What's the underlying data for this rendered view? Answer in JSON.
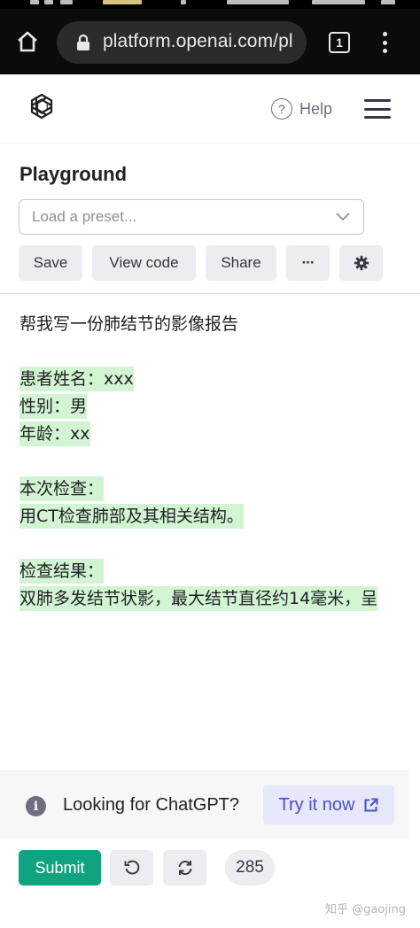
{
  "browser": {
    "url": "platform.openai.com/pl",
    "tab_count": "1",
    "icons": {
      "home": "home-icon",
      "lock": "lock-icon",
      "menu": "more-vertical-icon"
    }
  },
  "header": {
    "help_label": "Help",
    "icons": {
      "logo": "openai-logo",
      "help": "question-circle-icon",
      "menu": "hamburger-icon"
    }
  },
  "playground": {
    "title": "Playground",
    "preset_placeholder": "Load a preset...",
    "buttons": {
      "save": "Save",
      "view_code": "View code",
      "share": "Share",
      "more": "···"
    }
  },
  "editor": {
    "lines": [
      {
        "text": "帮我写一份肺结节的影像报告",
        "highlighted": false
      },
      {
        "text": "",
        "highlighted": false
      },
      {
        "text": "患者姓名：xxx",
        "highlighted": true
      },
      {
        "text": "性别：男",
        "highlighted": true
      },
      {
        "text": "年龄：xx",
        "highlighted": true
      },
      {
        "text": "",
        "highlighted": false
      },
      {
        "text": "本次检查：",
        "highlighted": true
      },
      {
        "text": "用CT检查肺部及其相关结构。",
        "highlighted": true
      },
      {
        "text": "",
        "highlighted": false
      },
      {
        "text": "检查结果：",
        "highlighted": true
      },
      {
        "text": "双肺多发结节状影，最大结节直径约14毫米，呈",
        "highlighted": true
      }
    ]
  },
  "footer": {
    "banner_text": "Looking for ChatGPT?",
    "try_label": "Try it now",
    "submit_label": "Submit",
    "token_count": "285",
    "icons": {
      "info": "info-icon",
      "external": "external-link-icon",
      "undo": "undo-icon",
      "regenerate": "refresh-icon"
    }
  },
  "watermark": "知乎 @gaojing",
  "colors": {
    "accent": "#10a37f",
    "highlight": "#d2f4d3",
    "try_bg": "#e6e7fb",
    "try_text": "#4b50c8"
  }
}
